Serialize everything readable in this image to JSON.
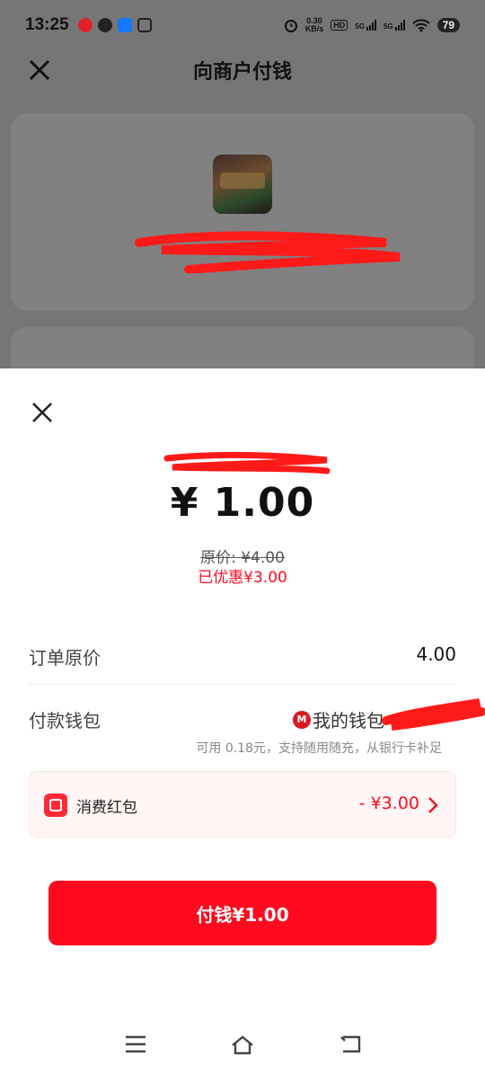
{
  "status_bar": {
    "time": "13:25",
    "net_speed_value": "0.30",
    "net_speed_unit": "KB/s",
    "hd": "HD",
    "sim1": "5G",
    "sim2": "5G",
    "battery": "79"
  },
  "nav": {
    "title": "向商户付钱"
  },
  "sheet": {
    "amount": "¥ 1.00",
    "original_price": "原价: ¥4.00",
    "discount": "已优惠¥3.00",
    "order_label": "订单原价",
    "order_value": "4.00",
    "wallet_label": "付款钱包",
    "wallet_logo": "M",
    "wallet_value": "我的钱包",
    "wallet_hint": "可用 0.18元，支持随用随充，从银行卡补足",
    "coupon_label": "消费红包",
    "coupon_value": "- ¥3.00",
    "pay_button": "付钱¥1.00"
  },
  "colors": {
    "accent_red": "#ff0a1e",
    "overlay_gray": "#767676",
    "coupon_bg": "#fff6f5"
  },
  "icons": [
    "close-icon",
    "merchant-image",
    "cmb-logo-icon",
    "red-packet-icon",
    "chevron-right-icon",
    "menu-icon",
    "home-icon",
    "back-icon"
  ]
}
